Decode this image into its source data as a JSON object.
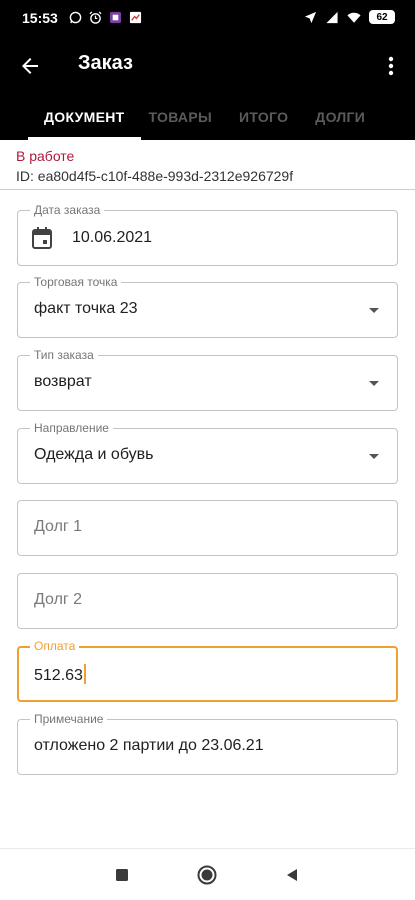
{
  "status_bar": {
    "time": "15:53",
    "battery": "62",
    "icons_left": [
      "whatsapp-icon",
      "alarm-icon",
      "app-notification-icon",
      "gallery-icon"
    ],
    "icons_right": [
      "location-arrow-icon",
      "signal-icon",
      "wifi-icon",
      "battery-icon"
    ]
  },
  "app_bar": {
    "title": "Заказ"
  },
  "tabs": [
    {
      "label": "ДОКУМЕНТ",
      "active": true
    },
    {
      "label": "ТОВАРЫ",
      "active": false
    },
    {
      "label": "ИТОГО",
      "active": false
    },
    {
      "label": "ДОЛГИ",
      "active": false
    }
  ],
  "document": {
    "state": "В работе",
    "id_text": "ID: ea80d4f5-c10f-488e-993d-2312e926729f"
  },
  "fields": {
    "order_date": {
      "label": "Дата заказа",
      "value": "10.06.2021"
    },
    "outlet": {
      "label": "Торговая точка",
      "value": "факт точка 23"
    },
    "order_type": {
      "label": "Тип заказа",
      "value": "возврат"
    },
    "direction": {
      "label": "Направление",
      "value": "Одежда и обувь"
    },
    "debt1": {
      "placeholder": "Долг 1",
      "value": ""
    },
    "debt2": {
      "placeholder": "Долг 2",
      "value": ""
    },
    "payment": {
      "label": "Оплата",
      "value": "512.63"
    },
    "note": {
      "label": "Примечание",
      "value": "отложено 2 партии до 23.06.21"
    }
  },
  "colors": {
    "accent": "#f0a030",
    "state": "#b0193a",
    "app_bar": "#000000"
  }
}
